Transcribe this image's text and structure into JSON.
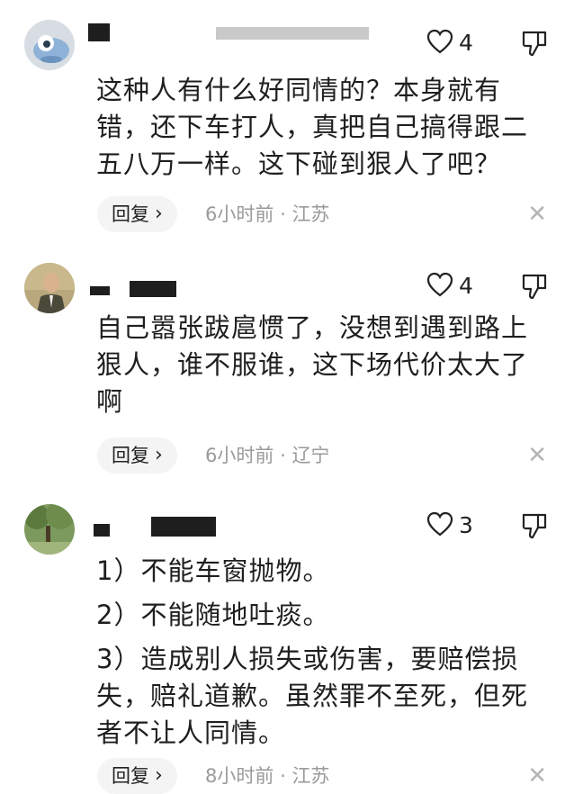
{
  "comments": [
    {
      "likes": "4",
      "text_lines": [
        "这种人有什么好同情的？本身就有错，还下车打人，真把自己搞得跟二五八万一样。这下碰到狠人了吧？"
      ],
      "reply_label": "回复",
      "time": "6小时前",
      "location": "江苏"
    },
    {
      "likes": "4",
      "text_lines": [
        "自己嚣张跋扈惯了，没想到遇到路上狠人，谁不服谁，这下场代价太大了啊"
      ],
      "reply_label": "回复",
      "time": "6小时前",
      "location": "辽宁"
    },
    {
      "likes": "3",
      "text_lines": [
        "1）不能车窗抛物。",
        "2）不能随地吐痰。",
        "3）造成别人损失或伤害，要赔偿损失，赔礼道歉。虽然罪不至死，但死者不让人同情。"
      ],
      "reply_label": "回复",
      "time": "8小时前",
      "location": "江苏"
    }
  ],
  "separator": "·",
  "icons": {
    "like": "heart-outline-icon",
    "dislike": "thumbs-down-icon",
    "close": "close-icon",
    "chevron": "chevron-right-icon"
  },
  "colors": {
    "meta_text": "#9a9a9a",
    "reply_bg": "#f4f4f4"
  }
}
